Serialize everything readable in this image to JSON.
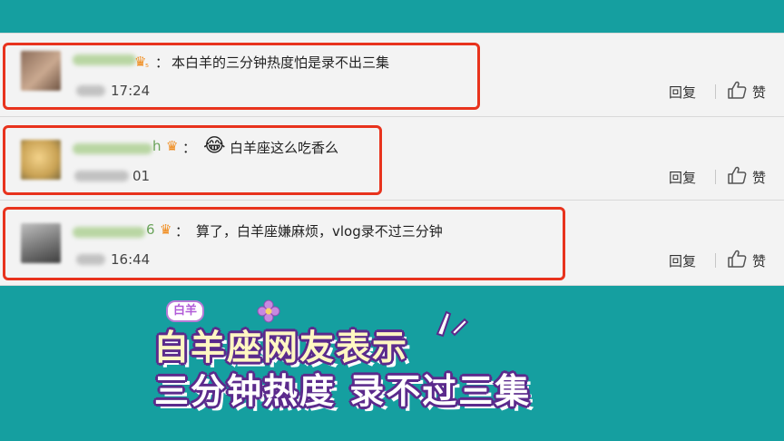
{
  "comments": [
    {
      "text": "本白羊的三分钟热度怕是录不出三集",
      "badge": "₅",
      "time": "17:24",
      "reply": "回复",
      "like": "赞"
    },
    {
      "text": "白羊座这么吃香么",
      "badge": "h",
      "time": "01",
      "reply": "回复",
      "like": "赞"
    },
    {
      "text": "算了，白羊座嫌麻烦，vlog录不过三分钟",
      "badge": "6",
      "time": "16:44",
      "reply": "回复",
      "like": "赞"
    }
  ],
  "caption": {
    "tag": "白羊",
    "line1": "白羊座网友表示",
    "line2": "三分钟热度 录不过三集"
  },
  "colors": {
    "background": "#159fa0",
    "highlight": "#e8331d",
    "caption_outline": "#5b2a8c"
  }
}
